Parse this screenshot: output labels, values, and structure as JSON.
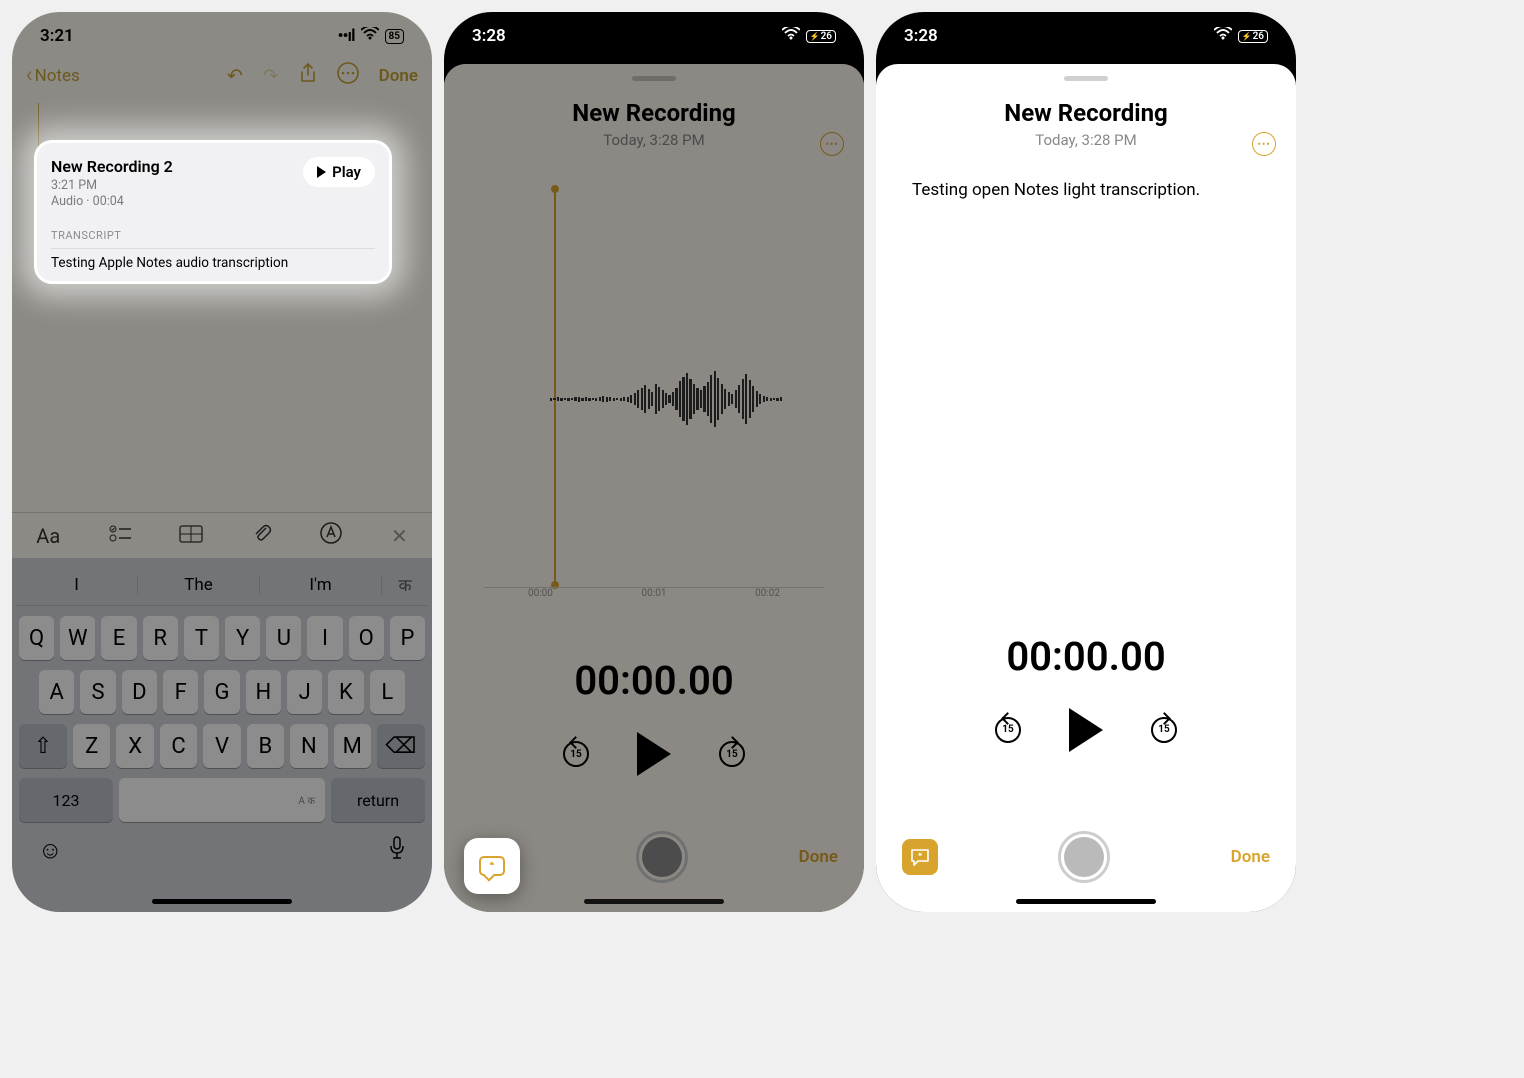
{
  "screen1": {
    "status_time": "3:21",
    "battery": "85",
    "back_label": "Notes",
    "done": "Done",
    "card": {
      "title": "New Recording 2",
      "time": "3:21 PM",
      "meta": "Audio · 00:04",
      "play": "Play",
      "tr_label": "TRANSCRIPT",
      "tr_text": "Testing Apple Notes audio transcription"
    },
    "kb_toolbar": [
      "Aa",
      "list-icon",
      "table-icon",
      "attach-icon",
      "markup-icon",
      "close-icon"
    ],
    "suggestions": [
      "I",
      "The",
      "I'm"
    ],
    "sug_script": "क",
    "keys_r1": [
      "Q",
      "W",
      "E",
      "R",
      "T",
      "Y",
      "U",
      "I",
      "O",
      "P"
    ],
    "keys_r2": [
      "A",
      "S",
      "D",
      "F",
      "G",
      "H",
      "J",
      "K",
      "L"
    ],
    "keys_r3": [
      "Z",
      "X",
      "C",
      "V",
      "B",
      "N",
      "M"
    ],
    "bottom": {
      "numbers": "123",
      "space_tag": "A क",
      "return": "return"
    }
  },
  "screen2": {
    "status_time": "3:28",
    "battery": "26",
    "title": "New Recording",
    "subtitle": "Today, 3:28 PM",
    "ticks": [
      "00:00",
      "00:01",
      "00:02"
    ],
    "timer": "00:00.00",
    "skip": "15",
    "done": "Done"
  },
  "screen3": {
    "status_time": "3:28",
    "battery": "26",
    "title": "New Recording",
    "subtitle": "Today, 3:28 PM",
    "transcript": "Testing open Notes light transcription.",
    "timer": "00:00.00",
    "skip": "15",
    "done": "Done"
  }
}
